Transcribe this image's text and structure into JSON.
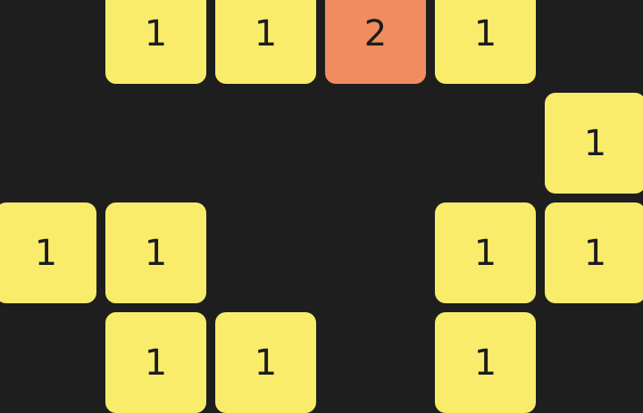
{
  "colors": {
    "background": "#1e1e1e",
    "one": "#f9ec6b",
    "two": "#f08c5e",
    "text": "#1c1c1c"
  },
  "tiles": [
    {
      "row": 0,
      "col": 1,
      "value": "1"
    },
    {
      "row": 0,
      "col": 2,
      "value": "1"
    },
    {
      "row": 0,
      "col": 3,
      "value": "2"
    },
    {
      "row": 0,
      "col": 4,
      "value": "1"
    },
    {
      "row": 1,
      "col": 5,
      "value": "1"
    },
    {
      "row": 2,
      "col": 0,
      "value": "1"
    },
    {
      "row": 2,
      "col": 1,
      "value": "1"
    },
    {
      "row": 2,
      "col": 4,
      "value": "1"
    },
    {
      "row": 2,
      "col": 5,
      "value": "1"
    },
    {
      "row": 3,
      "col": 1,
      "value": "1"
    },
    {
      "row": 3,
      "col": 2,
      "value": "1"
    },
    {
      "row": 3,
      "col": 4,
      "value": "1"
    }
  ]
}
